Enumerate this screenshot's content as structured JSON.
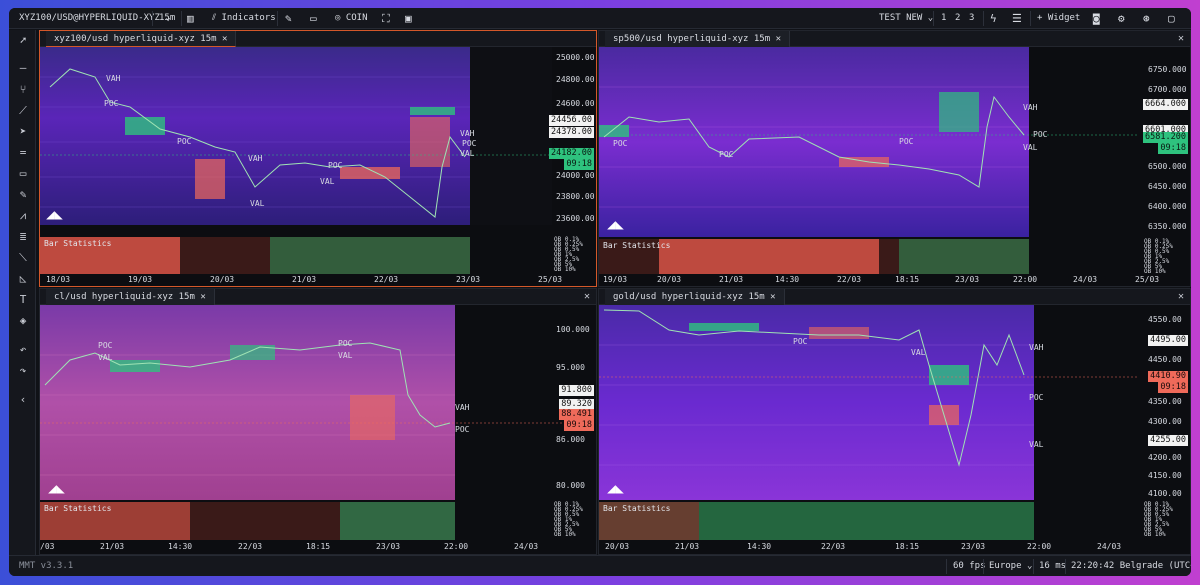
{
  "toolbar": {
    "symbol": "XYZ100/USD@HYPERLIQUID-XYZ",
    "interval": "15m",
    "indicators": "Indicators",
    "coin": "COIN",
    "layout": "TEST NEW",
    "layout_pages": [
      "1",
      "2",
      "3"
    ],
    "widget": "Widget"
  },
  "panels": [
    {
      "title": "xyz100/usd hyperliquid-xyz 15m",
      "close": "✕",
      "price_axis": [
        "25000.00",
        "24800.00",
        "24600.00",
        "24456.00",
        "24378.00",
        "24182.00",
        "09:18",
        "24000.00",
        "23800.00",
        "23600.00"
      ],
      "labels": [
        "VAH",
        "POC",
        "POC",
        "VAH",
        "VAL",
        "POC",
        "VAL",
        "VAH",
        "POC",
        "VAL",
        "POC",
        "VAL",
        "VAH",
        "POC",
        "VAL",
        "VAL"
      ],
      "stats_title": "Bar Statistics",
      "ob": [
        "OB 0.1%",
        "OB 0.25%",
        "OB 0.5%",
        "OB 1%",
        "OB 2.5%",
        "OB 5%",
        "OB 10%"
      ],
      "time_axis": [
        "18/03",
        "19/03",
        "20/03",
        "21/03",
        "22/03",
        "23/03",
        "25/03"
      ]
    },
    {
      "title": "sp500/usd hyperliquid-xyz 15m",
      "close": "✕",
      "price_axis": [
        "6750.000",
        "6700.000",
        "6664.000",
        "6601.000",
        "6581.200",
        "09:18",
        "6500.000",
        "6450.000",
        "6400.000",
        "6350.000"
      ],
      "labels": [
        "POC",
        "POC",
        "VAL",
        "POC",
        "VAH",
        "POC",
        "VAL",
        "POC",
        "VAL",
        "VAH",
        "POC",
        "VAL"
      ],
      "stats_title": "Bar Statistics",
      "ob": [
        "OB 0.1%",
        "OB 0.25%",
        "OB 0.5%",
        "OB 1%",
        "OB 2.5%",
        "OB 5%",
        "OB 10%"
      ],
      "time_axis": [
        "19/03",
        "20/03",
        "21/03",
        "14:30",
        "22/03",
        "18:15",
        "23/03",
        "22:00",
        "24/03",
        "25/03"
      ]
    },
    {
      "title": "cl/usd hyperliquid-xyz 15m",
      "close": "✕",
      "price_axis": [
        "100.000",
        "95.000",
        "91.800",
        "89.320",
        "88.491",
        "09:18",
        "86.000",
        "80.000"
      ],
      "labels": [
        "POC",
        "VAL",
        "VAL",
        "POC",
        "VAL",
        "POC",
        "VAL",
        "VAH",
        "POC"
      ],
      "stats_title": "Bar Statistics",
      "ob": [
        "OB 0.1%",
        "OB 0.25%",
        "OB 0.5%",
        "OB 1%",
        "OB 2.5%",
        "OB 5%",
        "OB 10%"
      ],
      "time_axis": [
        "/03",
        "21/03",
        "14:30",
        "22/03",
        "18:15",
        "23/03",
        "22:00",
        "24/03"
      ]
    },
    {
      "title": "gold/usd hyperliquid-xyz 15m",
      "close": "✕",
      "price_axis": [
        "4550.00",
        "4495.00",
        "4450.00",
        "4410.90",
        "09:18",
        "4350.00",
        "4300.00",
        "4255.00",
        "4200.00",
        "4150.00",
        "4100.00"
      ],
      "labels": [
        "POC",
        "VAL",
        "VAL",
        "VAH",
        "POC",
        "VAL"
      ],
      "stats_title": "Bar Statistics",
      "ob": [
        "OB 0.1%",
        "OB 0.25%",
        "OB 0.5%",
        "OB 1%",
        "OB 2.5%",
        "OB 5%",
        "OB 10%"
      ],
      "time_axis": [
        "20/03",
        "21/03",
        "14:30",
        "22/03",
        "18:15",
        "23/03",
        "22:00",
        "24/03"
      ]
    }
  ],
  "status": {
    "version": "MMT v3.3.1",
    "fps": "60 fps",
    "region": "Europe",
    "latency": "16 ms",
    "clock": "22:20:42 Belgrade (UTC+1)"
  },
  "colors": {
    "accent": "#d4582a",
    "up": "#2ec27e",
    "down": "#ef6a5a",
    "heatmap": "#6a2bd1"
  }
}
